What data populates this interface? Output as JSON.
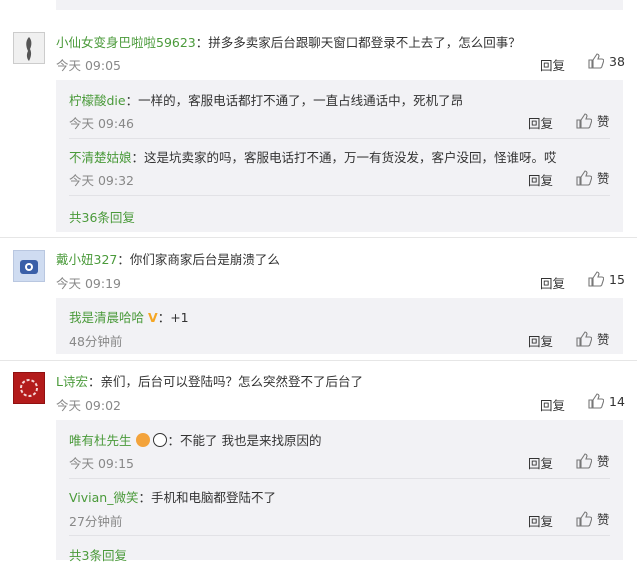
{
  "comments": [
    {
      "user": "小仙女变身巴啦啦59623",
      "text": "：拼多多卖家后台跟聊天窗口都登录不上去了，怎么回事？",
      "time": "今天 09:05",
      "reply": "回复",
      "likes": "38",
      "replies": [
        {
          "user": "柠檬酸die",
          "text": "：一样的，客服电话都打不通了，一直占线通话中，死机了昂",
          "time": "今天 09:46",
          "reply": "回复",
          "likes": "赞"
        },
        {
          "user": "不清楚姑娘",
          "text": "：这是坑卖家的吗，客服电话打不通，万一有货没发，客户没回，怪谁呀。哎",
          "time": "今天 09:32",
          "reply": "回复",
          "likes": "赞"
        }
      ],
      "more": "共36条回复"
    },
    {
      "user": "戴小妞327",
      "text": "：你们家商家后台是崩溃了么",
      "time": "今天 09:19",
      "reply": "回复",
      "likes": "15",
      "replies": [
        {
          "user": "我是清晨哈哈",
          "text": "：+1",
          "time": "48分钟前",
          "reply": "回复",
          "likes": "赞"
        }
      ]
    },
    {
      "user": "L诗宏",
      "text": "：亲们，后台可以登陆吗？怎么突然登不了后台了",
      "time": "今天 09:02",
      "reply": "回复",
      "likes": "14",
      "replies": [
        {
          "user": "唯有杜先生",
          "text": "：不能了 我也是来找原因的",
          "time": "今天 09:15",
          "reply": "回复",
          "likes": "赞"
        },
        {
          "user": "Vivian_微笑",
          "text": "：手机和电脑都登陆不了",
          "time": "27分钟前",
          "reply": "回复",
          "likes": "赞"
        }
      ],
      "more": "共3条回复"
    }
  ],
  "colors": {
    "username": "#4a9a3a",
    "time": "#888888",
    "reply_bg": "#f2f2f5"
  },
  "icons": {
    "like": "thumbs-up-icon",
    "badge": "vip-v-icon",
    "emoji": "emoji-icon"
  }
}
